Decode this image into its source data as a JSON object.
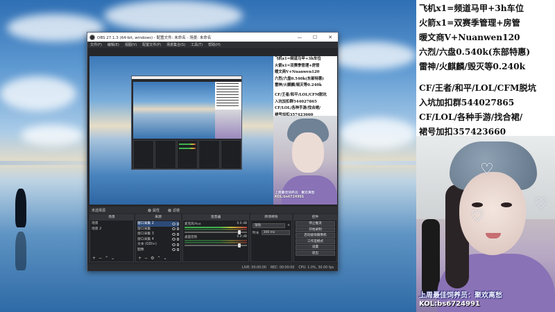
{
  "obs": {
    "title": "OBS 27.1.3 (64-bit, windows) - 配置文件: 未命名 - 场景: 未命名",
    "window_controls": {
      "minimize": "—",
      "maximize": "☐",
      "close": "✕"
    },
    "menu": [
      "文件(F)",
      "编辑(E)",
      "视图(V)",
      "配置文件(P)",
      "场景集合(S)",
      "工具(T)",
      "帮助(H)"
    ],
    "dockbar": {
      "scene_label": "未选择源",
      "properties": "属性",
      "filters": "滤镜"
    },
    "docks": {
      "scenes": {
        "title": "场景",
        "items": [
          "场景",
          "场景 2"
        ]
      },
      "sources": {
        "title": "来源",
        "items": [
          "窗口采集 2",
          "窗口采集",
          "窗口采集 3",
          "窗口采集 4",
          "文本 (GDI+)",
          "图像"
        ]
      },
      "mixer": {
        "title": "混音器",
        "tracks": [
          {
            "name": "麦克风/Aux",
            "level": "0.0 dB"
          },
          {
            "name": "桌面音频",
            "level": "0.0 dB"
          }
        ]
      },
      "transitions": {
        "title": "转场特效",
        "type": "渐隐",
        "duration_label": "时长",
        "duration": "300 ms"
      },
      "controls": {
        "title": "控件",
        "buttons": [
          "停止推流",
          "开始录制",
          "启动虚拟摄像机",
          "工作室模式",
          "设置",
          "退出"
        ]
      }
    },
    "status": {
      "live": "LIVE: 00:00:00",
      "rec": "REC: 00:00:00",
      "cpu": "CPU: 1.0%, 30.00 fps"
    }
  },
  "panel": {
    "lines": [
      "飞机x1=频道马甲+3h车位",
      "火箭x1=双赛季管理+房管",
      "暖文商V+Nuanwen120",
      "六烈/六盘0.540k(东部特惠)",
      "雷神/火麒麟/毁灭等0.240k"
    ],
    "lines2": [
      "CF/王者/和平/LOL/CFM脱坑",
      "入坑加扣群544027865",
      "CF/LOL/各种手游/找合裙/",
      "裙号加扣357423660"
    ],
    "caption": "上周最佳饲养员：聚欢离愁",
    "kol": "KOL:bs6724991"
  },
  "preview_panel": {
    "lines": [
      "飞机x1=频道马甲+3h车位",
      "火箭x1=双赛季管理+房管",
      "暖文商V+Nuanwen120",
      "六烈/六盘0.540k(东部特惠)",
      "雷神/火麒麟/毁灭等0.240k",
      "CF/王者/和平/LOL/CFM脱坑",
      "入坑加扣群544027865",
      "CF/LOL/各种手游/找合裙/",
      "裙号加扣357423660"
    ],
    "caption": "上周最佳饲养员：聚欢离愁",
    "kol": "KOL:bs6724991"
  },
  "colors": {
    "obs_bg": "#26272b",
    "selected": "#2d4a77",
    "meter_green": "#3fb34f",
    "meter_yellow": "#c9c23a",
    "meter_red": "#c2413a"
  },
  "icons": [
    "obs-logo-icon",
    "eye-icon",
    "lock-icon",
    "gear-icon",
    "add-icon",
    "remove-icon",
    "up-icon",
    "down-icon",
    "mute-icon"
  ]
}
